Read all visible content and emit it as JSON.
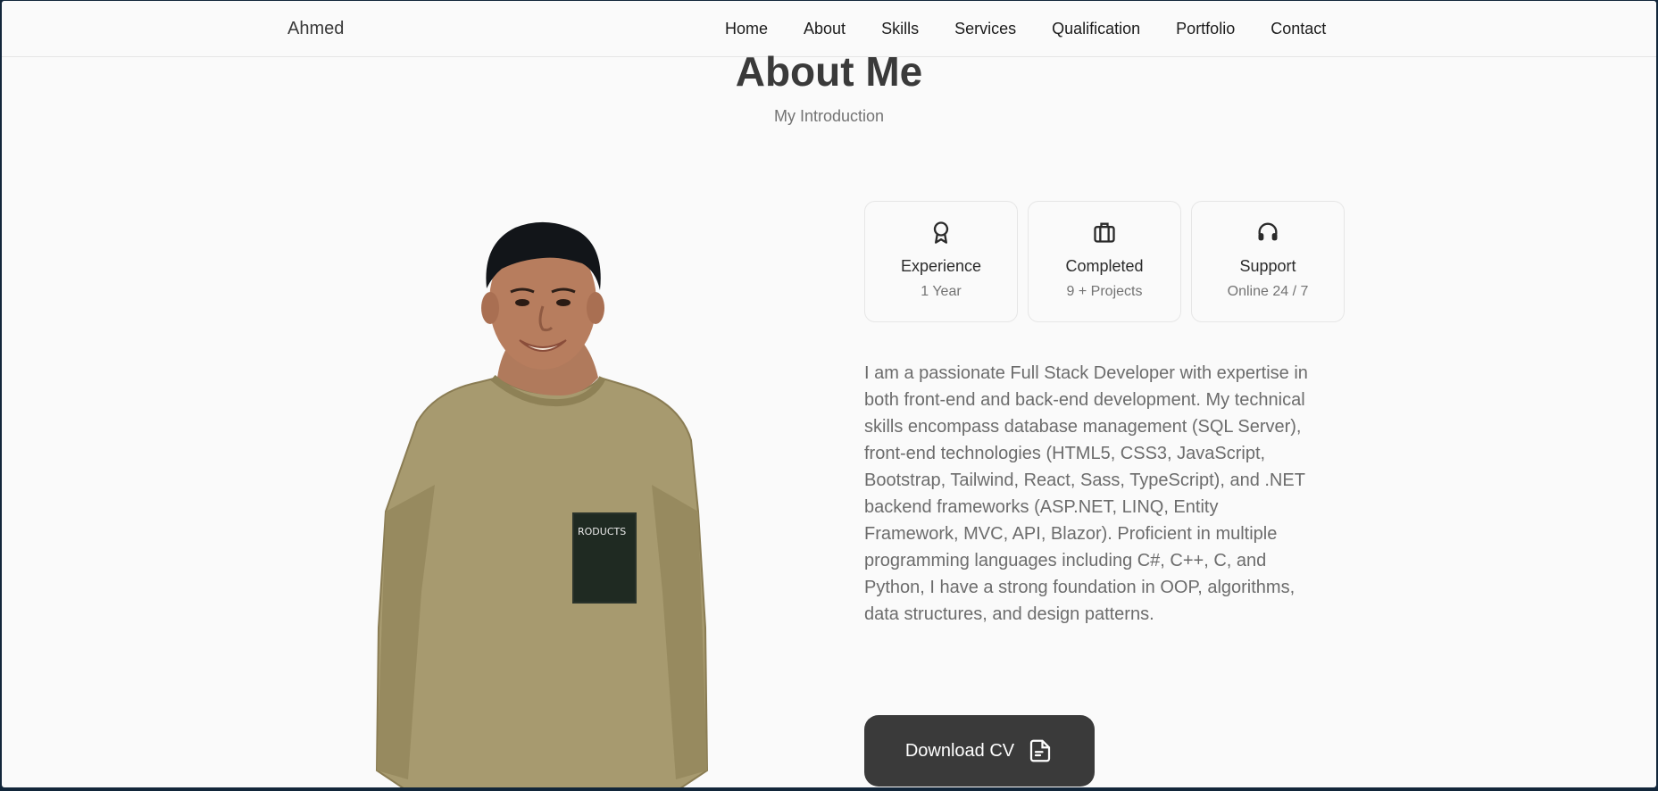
{
  "header": {
    "logo": "Ahmed",
    "nav": [
      "Home",
      "About",
      "Skills",
      "Services",
      "Qualification",
      "Portfolio",
      "Contact"
    ]
  },
  "section": {
    "title": "About Me",
    "subtitle": "My Introduction"
  },
  "stats": [
    {
      "icon": "award-icon",
      "title": "Experience",
      "value": "1 Year"
    },
    {
      "icon": "briefcase-icon",
      "title": "Completed",
      "value": "9 + Projects"
    },
    {
      "icon": "headset-icon",
      "title": "Support",
      "value": "Online 24 / 7"
    }
  ],
  "bio": "I am a passionate Full Stack Developer with expertise in both front-end and back-end development. My technical skills encompass database management (SQL Server), front-end technologies (HTML5, CSS3, JavaScript, Bootstrap, Tailwind, React, Sass, TypeScript), and .NET backend frameworks (ASP.NET, LINQ, Entity Framework, MVC, API, Blazor). Proficient in multiple programming languages including C#, C++, C, and Python, I have a strong foundation in OOP, algorithms, data structures, and design patterns.",
  "cta": {
    "label": "Download CV",
    "icon": "file-icon"
  },
  "photo": {
    "shirt_text": "RODUCTS"
  },
  "colors": {
    "background": "#fafafa",
    "text_dark": "#3a3a3a",
    "text_muted": "#737373",
    "button_bg": "#3a3a3a"
  }
}
